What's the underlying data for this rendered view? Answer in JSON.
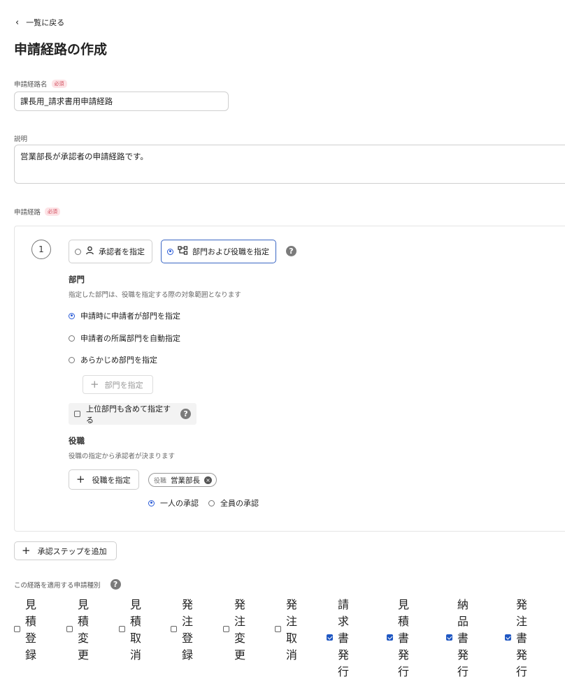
{
  "nav": {
    "back_label": "一覧に戻る"
  },
  "page": {
    "title": "申請経路の作成"
  },
  "route_name": {
    "label": "申請経路名",
    "required": "必須",
    "value": "課長用_請求書用申請経路"
  },
  "description": {
    "label": "説明",
    "value": "営業部長が承認者の申請経路です。"
  },
  "route": {
    "label": "申請経路",
    "required": "必須"
  },
  "step": {
    "number": "1",
    "option_approver": "承認者を指定",
    "option_dept_role": "部門および役職を指定",
    "selected_option": "部門および役職を指定",
    "dept": {
      "title": "部門",
      "hint": "指定した部門は、役職を指定する際の対象範囲となります",
      "options": [
        "申請時に申請者が部門を指定",
        "申請者の所属部門を自動指定",
        "あらかじめ部門を指定"
      ],
      "selected": "申請時に申請者が部門を指定",
      "specify_button": "部門を指定",
      "include_upper_label": "上位部門も含めて指定する",
      "include_upper_checked": false
    },
    "role": {
      "title": "役職",
      "hint": "役職の指定から承認者が決まります",
      "specify_button": "役職を指定",
      "chip_label": "役職",
      "chip_value": "営業部長",
      "approval_options": [
        "一人の承認",
        "全員の承認"
      ],
      "approval_selected": "一人の承認"
    }
  },
  "add_step_button": "承認ステップを追加",
  "apply_types": {
    "label": "この経路を適用する申請種別",
    "items": [
      {
        "label": "見積登録",
        "checked": false
      },
      {
        "label": "見積変更",
        "checked": false
      },
      {
        "label": "見積取消",
        "checked": false
      },
      {
        "label": "発注登録",
        "checked": false
      },
      {
        "label": "発注変更",
        "checked": false
      },
      {
        "label": "発注取消",
        "checked": false
      },
      {
        "label": "請求書発行",
        "checked": true
      },
      {
        "label": "見積書発行",
        "checked": true
      },
      {
        "label": "納品書発行",
        "checked": true
      },
      {
        "label": "発注書発行",
        "checked": true
      }
    ]
  },
  "colors": {
    "accent": "#2a5bd7",
    "required_badge_bg": "#fde3e6",
    "required_badge_text": "#d04a5a"
  },
  "icons": {
    "back": "chevron-left-icon",
    "person": "person-icon",
    "org": "org-chart-icon",
    "help": "help-icon",
    "plus": "plus-icon",
    "clear": "clear-icon"
  }
}
